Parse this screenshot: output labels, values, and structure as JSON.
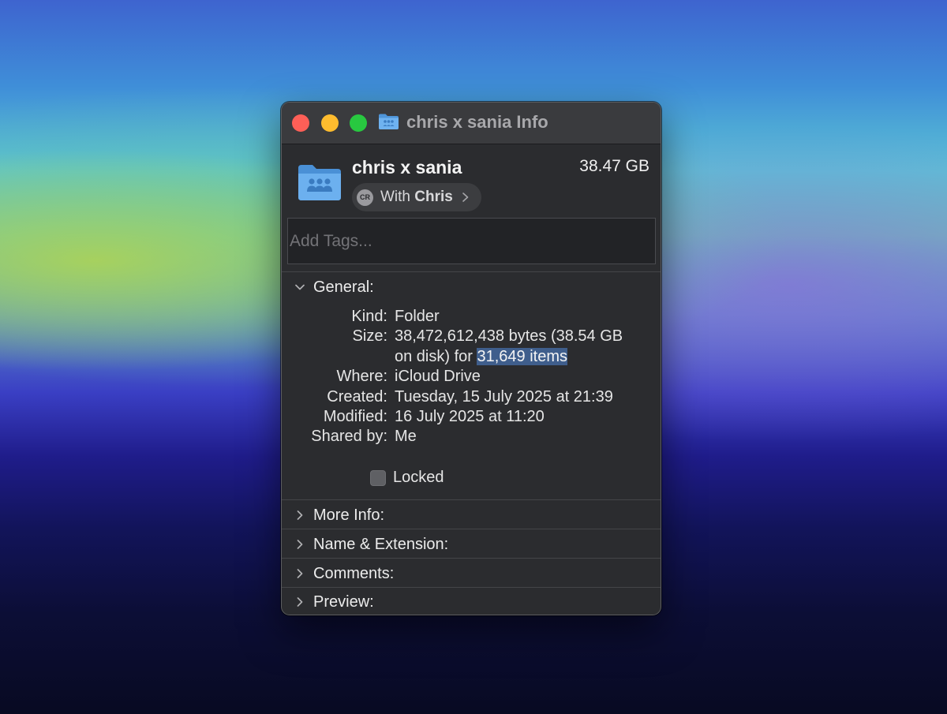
{
  "window": {
    "title": "chris x sania Info"
  },
  "header": {
    "name": "chris x sania",
    "size": "38.47 GB",
    "share": {
      "avatar_initials": "CR",
      "prefix": "With ",
      "name": "Chris",
      "icon": "chevron-right-icon"
    },
    "tags_placeholder": "Add Tags..."
  },
  "general": {
    "heading": "General:",
    "rows": [
      {
        "label": "Kind:",
        "value": "Folder"
      },
      {
        "label": "Size:",
        "value_line1": "38,472,612,438 bytes (38.54 GB",
        "value_line2_prefix": "on disk) for ",
        "value_highlight": "31,649 items"
      },
      {
        "label": "Where:",
        "value": "iCloud Drive"
      },
      {
        "label": "Created:",
        "value": "Tuesday, 15 July 2025 at 21:39"
      },
      {
        "label": "Modified:",
        "value": "16 July 2025 at 11:20"
      },
      {
        "label": "Shared by:",
        "value": "Me"
      }
    ],
    "locked_label": "Locked",
    "locked_checked": false
  },
  "sections": [
    {
      "label": "More Info:"
    },
    {
      "label": "Name & Extension:"
    },
    {
      "label": "Comments:"
    },
    {
      "label": "Preview:"
    }
  ],
  "colors": {
    "folder_blue": "#5aa2e6",
    "close": "#fe5f57",
    "minimize": "#febc2e",
    "zoom": "#28c840",
    "selection": "#3f5e8c"
  }
}
